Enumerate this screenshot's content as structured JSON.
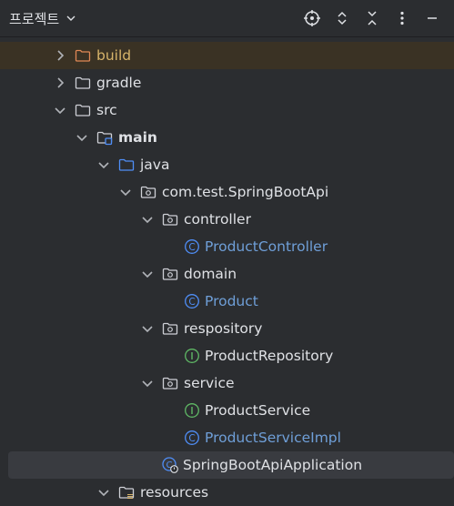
{
  "header": {
    "title": "프로젝트"
  },
  "colors": {
    "background": "#2b2d30",
    "selected": "#393b40",
    "excluded_row": "#3a3224",
    "modified_text": "#6f9fd8",
    "folder_blue": "#4f8ef7",
    "class_icon": "#4f8ef7",
    "interface_icon": "#5fb865"
  },
  "tree": {
    "build": "build",
    "gradle": "gradle",
    "src": "src",
    "main": "main",
    "java": "java",
    "package": "com.test.SpringBootApi",
    "controller": "controller",
    "product_controller": "ProductController",
    "domain": "domain",
    "product": "Product",
    "respository": "respository",
    "product_repository": "ProductRepository",
    "service": "service",
    "product_service": "ProductService",
    "product_service_impl": "ProductServiceImpl",
    "application": "SpringBootApiApplication",
    "resources": "resources"
  }
}
